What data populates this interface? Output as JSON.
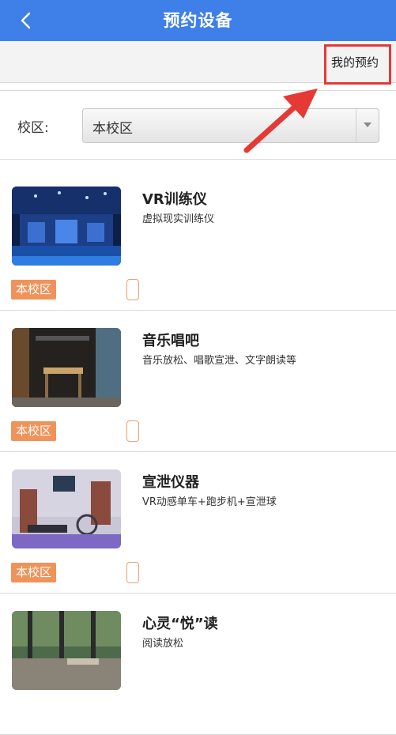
{
  "header": {
    "title": "预约设备"
  },
  "topbar": {
    "my_reservations": "我的预约"
  },
  "campus": {
    "label": "校区:",
    "selected": "本校区"
  },
  "devices": [
    {
      "name": "VR训练仪",
      "desc": "虚拟现实训练仪",
      "tag": "本校区"
    },
    {
      "name": "音乐唱吧",
      "desc": "音乐放松、唱歌宣泄、文字朗读等",
      "tag": "本校区"
    },
    {
      "name": "宣泄仪器",
      "desc": "VR动感单车+跑步机+宣泄球",
      "tag": "本校区"
    },
    {
      "name": "心灵“悦”读",
      "desc": "阅读放松",
      "tag": ""
    }
  ],
  "colors": {
    "header_bg": "#3e7fe8",
    "tag_bg": "#f0935a",
    "annotation": "#e53935"
  }
}
